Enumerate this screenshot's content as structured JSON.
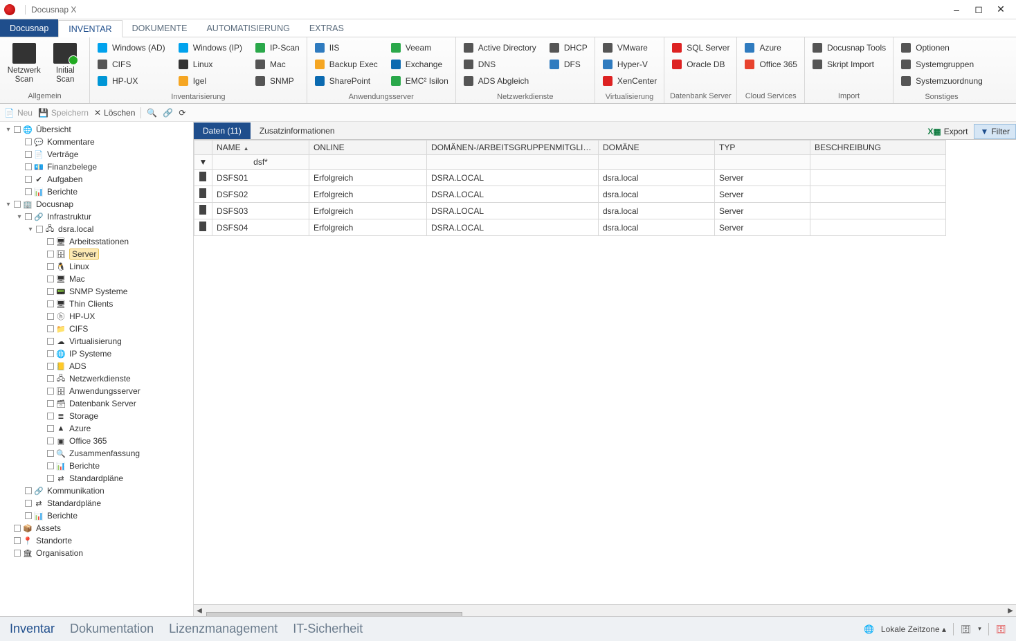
{
  "title": "Docusnap X",
  "tabs": {
    "file": "Docusnap",
    "inventar": "INVENTAR",
    "dokumente": "DOKUMENTE",
    "automatisierung": "AUTOMATISIERUNG",
    "extras": "EXTRAS"
  },
  "ribbon": {
    "allgemein": {
      "label": "Allgemein",
      "netzwerk_scan": "Netzwerk Scan",
      "initial_scan": "Initial Scan"
    },
    "inventarisierung": {
      "label": "Inventarisierung",
      "items": [
        [
          "Windows (AD)",
          "#00a2ed"
        ],
        [
          "CIFS",
          "#555"
        ],
        [
          "HP-UX",
          "#0096d6"
        ],
        [
          "Windows (IP)",
          "#00a2ed"
        ],
        [
          "Linux",
          "#333"
        ],
        [
          "Igel",
          "#f5a623"
        ],
        [
          "IP-Scan",
          "#2aa84a"
        ],
        [
          "Mac",
          "#555"
        ],
        [
          "SNMP",
          "#555"
        ]
      ]
    },
    "anwendungsserver": {
      "label": "Anwendungsserver",
      "items": [
        [
          "IIS",
          "#2f7bbf"
        ],
        [
          "Backup Exec",
          "#f5a623"
        ],
        [
          "SharePoint",
          "#0b6ab0"
        ],
        [
          "Veeam",
          "#2aa84a"
        ],
        [
          "Exchange",
          "#0b6ab0"
        ],
        [
          "EMC² Isilon",
          "#2aa84a"
        ]
      ]
    },
    "netzwerkdienste": {
      "label": "Netzwerkdienste",
      "items": [
        [
          "Active Directory",
          "#555"
        ],
        [
          "DNS",
          "#555"
        ],
        [
          "ADS Abgleich",
          "#555"
        ],
        [
          "DHCP",
          "#555"
        ],
        [
          "DFS",
          "#2f7bbf"
        ]
      ]
    },
    "virtualisierung": {
      "label": "Virtualisierung",
      "items": [
        [
          "VMware",
          "#555"
        ],
        [
          "Hyper-V",
          "#2f7bbf"
        ],
        [
          "XenCenter",
          "#d22"
        ]
      ]
    },
    "datenbank": {
      "label": "Datenbank Server",
      "items": [
        [
          "SQL Server",
          "#d22"
        ],
        [
          "Oracle DB",
          "#d22"
        ]
      ]
    },
    "cloud": {
      "label": "Cloud Services",
      "items": [
        [
          "Azure",
          "#2f7bbf"
        ],
        [
          "Office 365",
          "#e8432e"
        ]
      ]
    },
    "import": {
      "label": "Import",
      "items": [
        [
          "Docusnap Tools",
          "#555"
        ],
        [
          "Skript Import",
          "#555"
        ]
      ]
    },
    "sonstiges": {
      "label": "Sonstiges",
      "items": [
        [
          "Optionen",
          "#555"
        ],
        [
          "Systemgruppen",
          "#555"
        ],
        [
          "Systemzuordnung",
          "#555"
        ]
      ]
    }
  },
  "actionbar": {
    "neu": "Neu",
    "speichern": "Speichern",
    "loeschen": "Löschen"
  },
  "tree": {
    "root": [
      {
        "label": "Übersicht",
        "icon": "🌐",
        "children": [
          {
            "label": "Kommentare",
            "icon": "💬"
          },
          {
            "label": "Verträge",
            "icon": "📄"
          },
          {
            "label": "Finanzbelege",
            "icon": "💶"
          },
          {
            "label": "Aufgaben",
            "icon": "✔"
          },
          {
            "label": "Berichte",
            "icon": "📊"
          }
        ]
      },
      {
        "label": "Docusnap",
        "icon": "🏢",
        "children": [
          {
            "label": "Infrastruktur",
            "icon": "🔗",
            "children": [
              {
                "label": "dsra.local",
                "icon": "🖧",
                "children": [
                  {
                    "label": "Arbeitsstationen",
                    "icon": "🖥"
                  },
                  {
                    "label": "Server",
                    "icon": "🗄",
                    "selected": true
                  },
                  {
                    "label": "Linux",
                    "icon": "🐧"
                  },
                  {
                    "label": "Mac",
                    "icon": "🖥"
                  },
                  {
                    "label": "SNMP Systeme",
                    "icon": "📟"
                  },
                  {
                    "label": "Thin Clients",
                    "icon": "🖥"
                  },
                  {
                    "label": "HP-UX",
                    "icon": "ⓗ"
                  },
                  {
                    "label": "CIFS",
                    "icon": "📁"
                  },
                  {
                    "label": "Virtualisierung",
                    "icon": "☁"
                  },
                  {
                    "label": "IP Systeme",
                    "icon": "🌐"
                  },
                  {
                    "label": "ADS",
                    "icon": "📒"
                  },
                  {
                    "label": "Netzwerkdienste",
                    "icon": "🖧"
                  },
                  {
                    "label": "Anwendungsserver",
                    "icon": "🗄"
                  },
                  {
                    "label": "Datenbank Server",
                    "icon": "🗃"
                  },
                  {
                    "label": "Storage",
                    "icon": "≣"
                  },
                  {
                    "label": "Azure",
                    "icon": "▲"
                  },
                  {
                    "label": "Office 365",
                    "icon": "▣"
                  },
                  {
                    "label": "Zusammenfassung",
                    "icon": "🔍"
                  },
                  {
                    "label": "Berichte",
                    "icon": "📊"
                  },
                  {
                    "label": "Standardpläne",
                    "icon": "⇄"
                  }
                ]
              }
            ]
          },
          {
            "label": "Kommunikation",
            "icon": "🔗"
          },
          {
            "label": "Standardpläne",
            "icon": "⇄"
          },
          {
            "label": "Berichte",
            "icon": "📊"
          }
        ]
      },
      {
        "label": "Assets",
        "icon": "📦"
      },
      {
        "label": "Standorte",
        "icon": "📍"
      },
      {
        "label": "Organisation",
        "icon": "🏛"
      }
    ]
  },
  "right": {
    "tab_data": "Daten (11)",
    "tab_zusatz": "Zusatzinformationen",
    "export": "Export",
    "filter": "Filter",
    "columns": [
      "",
      "NAME",
      "ONLINE",
      "DOMÄNEN-/ARBEITSGRUPPENMITGLIEDSCHA...",
      "DOMÄNE",
      "TYP",
      "BESCHREIBUNG"
    ],
    "filter_value": "dsf*",
    "rows": [
      {
        "name": "DSFS01",
        "online": "Erfolgreich",
        "member": "DSRA.LOCAL",
        "domain": "dsra.local",
        "typ": "Server",
        "beschr": ""
      },
      {
        "name": "DSFS02",
        "online": "Erfolgreich",
        "member": "DSRA.LOCAL",
        "domain": "dsra.local",
        "typ": "Server",
        "beschr": ""
      },
      {
        "name": "DSFS03",
        "online": "Erfolgreich",
        "member": "DSRA.LOCAL",
        "domain": "dsra.local",
        "typ": "Server",
        "beschr": ""
      },
      {
        "name": "DSFS04",
        "online": "Erfolgreich",
        "member": "DSRA.LOCAL",
        "domain": "dsra.local",
        "typ": "Server",
        "beschr": ""
      }
    ]
  },
  "footer": {
    "links": [
      "Inventar",
      "Dokumentation",
      "Lizenzmanagement",
      "IT-Sicherheit"
    ],
    "timezone": "Lokale Zeitzone"
  }
}
